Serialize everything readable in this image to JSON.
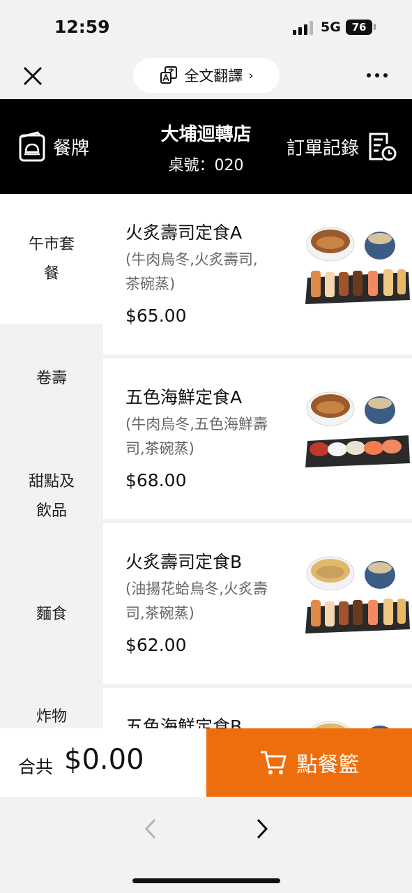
{
  "status_bar": {
    "time": "12:59",
    "network": "5G",
    "battery": "76"
  },
  "browser": {
    "translate_label": "全文翻譯"
  },
  "header": {
    "menu_label": "餐牌",
    "shop_name": "大埔迴轉店",
    "table_label": "桌號：020",
    "orders_label": "訂單記錄"
  },
  "categories": [
    {
      "label": "午市套\n餐",
      "active": true
    },
    {
      "label": "卷壽"
    },
    {
      "label": "甜點及\n飲品"
    },
    {
      "label": "麵食"
    },
    {
      "label": "炸物"
    }
  ],
  "items": [
    {
      "name": "火炙壽司定食A",
      "desc": "(牛肉烏冬,火炙壽司,茶碗蒸)",
      "price": "$65.00"
    },
    {
      "name": "五色海鮮定食A",
      "desc": "(牛肉烏冬,五色海鮮壽司,茶碗蒸)",
      "price": "$68.00"
    },
    {
      "name": "火炙壽司定食B",
      "desc": "(油揚花蛤烏冬,火炙壽司,茶碗蒸)",
      "price": "$62.00"
    },
    {
      "name": "五色海鮮定食B"
    }
  ],
  "cart": {
    "total_label": "合共",
    "total_amount": "$0.00",
    "button_label": "點餐籃"
  },
  "colors": {
    "accent": "#ee6e0d",
    "header_bg": "#000000"
  },
  "icons": [
    "close-icon",
    "translate-icon",
    "chevron-right-icon",
    "more-icon",
    "menu-card-icon",
    "order-history-icon",
    "cart-icon",
    "back-icon",
    "forward-icon"
  ]
}
